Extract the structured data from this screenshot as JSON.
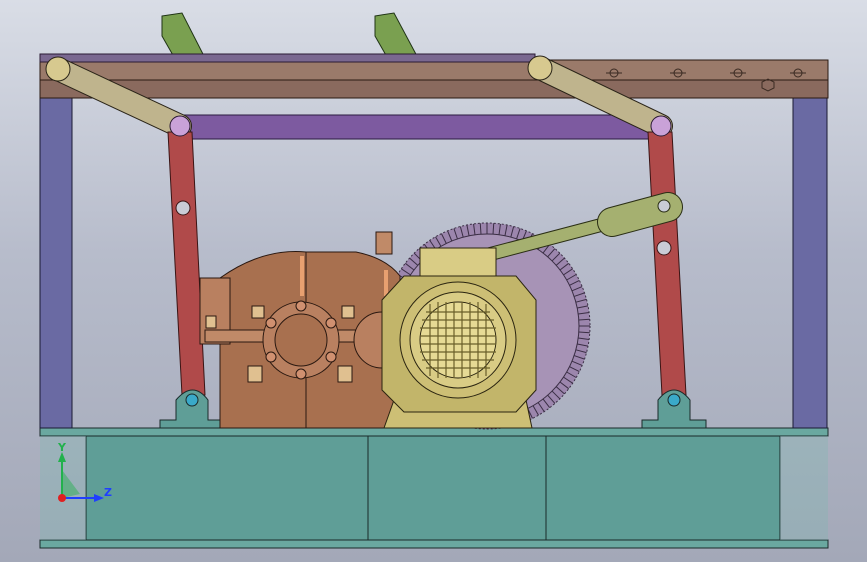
{
  "viewport": {
    "width": 867,
    "height": 562
  },
  "axis_triad": {
    "y_label": "Y",
    "z_label": "Z",
    "colors": {
      "y": "#22b14c",
      "z": "#1f3fff",
      "x": "#e02020"
    }
  },
  "colors": {
    "base_frame": "#5f9e97",
    "frame_post": "#6a6aa3",
    "top_beam": "#9a7a6a",
    "mid_beam": "#7d5aa0",
    "upper_arm": "#bfb48d",
    "link_rod": "#b04a4a",
    "clamp": "#7aa050",
    "gearbox": "#a8704f",
    "motor": "#cdbf75",
    "gear_wheel": "#9c86ad",
    "actuator": "#a5b070",
    "pin": "#d7c98f"
  }
}
